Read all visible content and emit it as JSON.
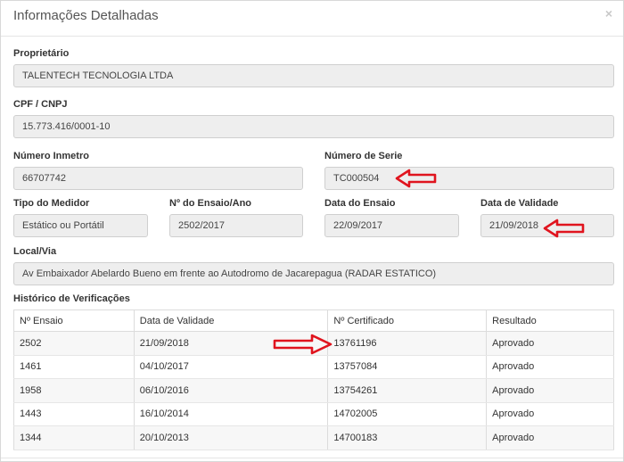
{
  "header": {
    "title": "Informações Detalhadas",
    "close_glyph": "×"
  },
  "fields": {
    "proprietario": {
      "label": "Proprietário",
      "value": "TALENTECH TECNOLOGIA LTDA"
    },
    "cpf_cnpj": {
      "label": "CPF / CNPJ",
      "value": "15.773.416/0001-10"
    },
    "numero_inmetro": {
      "label": "Número Inmetro",
      "value": "66707742"
    },
    "numero_serie": {
      "label": "Número de Serie",
      "value": "TC000504"
    },
    "tipo_medidor": {
      "label": "Tipo do Medidor",
      "value": "Estático ou Portátil"
    },
    "ensaio_ano": {
      "label": "Nº do Ensaio/Ano",
      "value": "2502/2017"
    },
    "data_ensaio": {
      "label": "Data do Ensaio",
      "value": "22/09/2017"
    },
    "data_validade": {
      "label": "Data de Validade",
      "value": "21/09/2018"
    },
    "local_via": {
      "label": "Local/Via",
      "value": "Av Embaixador Abelardo Bueno em frente ao Autodromo de Jacarepagua (RADAR ESTATICO)"
    }
  },
  "history": {
    "title": "Histórico de Verificações",
    "columns": [
      "Nº Ensaio",
      "Data de Validade",
      "Nº Certificado",
      "Resultado"
    ],
    "rows": [
      [
        "2502",
        "21/09/2018",
        "13761196",
        "Aprovado"
      ],
      [
        "1461",
        "04/10/2017",
        "13757084",
        "Aprovado"
      ],
      [
        "1958",
        "06/10/2016",
        "13754261",
        "Aprovado"
      ],
      [
        "1443",
        "16/10/2014",
        "14702005",
        "Aprovado"
      ],
      [
        "1344",
        "20/10/2013",
        "14700183",
        "Aprovado"
      ]
    ]
  },
  "annotations": {
    "arrow_color": "#e0141e"
  }
}
